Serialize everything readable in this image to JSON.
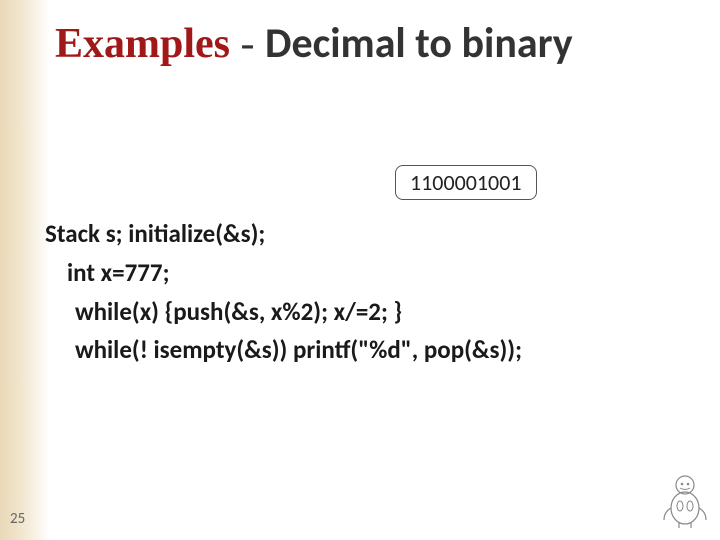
{
  "title": {
    "examples": "Examples",
    "dash": " - ",
    "subject": "Decimal to binary"
  },
  "result": "1100001001",
  "code": {
    "line1": "Stack s; initialize(&s);",
    "line2": "int x=777;",
    "line3": "while(x) {push(&s, x%2); x/=2; }",
    "line4": "while(! isempty(&s)) printf(\"%d\", pop(&s));"
  },
  "page_number": "25"
}
